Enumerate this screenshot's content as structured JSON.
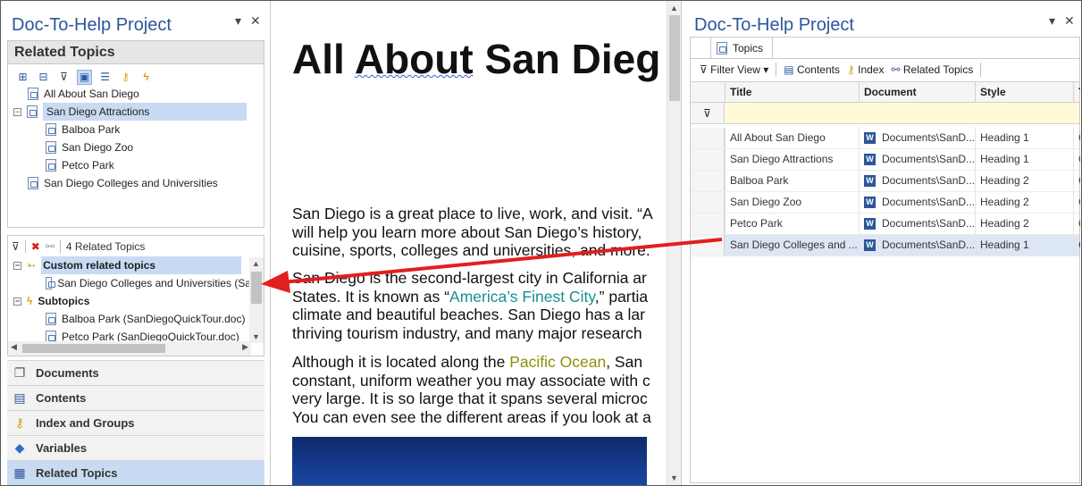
{
  "left_pane": {
    "title": "Doc-To-Help Project",
    "pin": "▾",
    "close": "✕",
    "related_header": "Related Topics",
    "tree": [
      {
        "label": "All About San Diego",
        "level": 1,
        "expander": "",
        "selected": false
      },
      {
        "label": "San Diego Attractions",
        "level": 0,
        "expander": "−",
        "selected": true
      },
      {
        "label": "Balboa Park",
        "level": 2,
        "expander": "",
        "selected": false
      },
      {
        "label": "San Diego Zoo",
        "level": 2,
        "expander": "",
        "selected": false
      },
      {
        "label": "Petco Park",
        "level": 2,
        "expander": "",
        "selected": false
      },
      {
        "label": "San Diego Colleges and Universities",
        "level": 1,
        "expander": "",
        "selected": false
      }
    ],
    "related_count": "4 Related Topics",
    "related_list": [
      {
        "label": "Custom related topics",
        "group": true,
        "expander": "−",
        "selected": true
      },
      {
        "label": "San Diego Colleges and Universities (Sa",
        "group": false,
        "expander": "",
        "selected": false
      },
      {
        "label": "Subtopics",
        "group": true,
        "expander": "−",
        "selected": false
      },
      {
        "label": "Balboa Park (SanDiegoQuickTour.doc)",
        "group": false,
        "expander": "",
        "selected": false
      },
      {
        "label": "Petco Park (SanDiegoQuickTour.doc)",
        "group": false,
        "expander": "",
        "selected": false
      }
    ],
    "nav": [
      {
        "label": "Documents",
        "icon": "documents-icon",
        "active": false
      },
      {
        "label": "Contents",
        "icon": "contents-icon",
        "active": false
      },
      {
        "label": "Index and Groups",
        "icon": "key-icon",
        "active": false
      },
      {
        "label": "Variables",
        "icon": "variables-icon",
        "active": false
      },
      {
        "label": "Related Topics",
        "icon": "related-topics-icon",
        "active": true
      }
    ]
  },
  "document": {
    "heading_part1": "All ",
    "heading_part2": "About",
    "heading_part3": " San Dieg",
    "p1": [
      "San Diego is a great place to live, work, and visit. “A",
      "will help you learn more about San Diego’s history,",
      "cuisine, sports, colleges and universities, and more."
    ],
    "p2a": "San Diego is the second-largest city in California ar",
    "p2b_pre": "States. It is known as “",
    "p2b_link": "America’s Finest City",
    "p2b_post": ",” partia",
    "p2c": "climate and beautiful beaches. San Diego has a lar",
    "p2d": "thriving tourism industry, and many major research",
    "p3a_pre": "Although it is located along the ",
    "p3a_link": "Pacific Ocean",
    "p3a_post": ", San",
    "p3b": "constant, uniform weather you may associate with c",
    "p3c": "very large. It is so large that it spans several microc",
    "p3d": "You can even see the different areas if you look at a"
  },
  "right_pane": {
    "title": "Doc-To-Help Project",
    "pin": "▾",
    "close": "✕",
    "tab": "Topics",
    "toolbar": {
      "filter_view": "Filter View",
      "contents": "Contents",
      "index": "Index",
      "related_topics": "Related Topics"
    },
    "columns": [
      "Title",
      "Document",
      "Style",
      "T"
    ],
    "rows": [
      {
        "title": "All About San Diego",
        "document": "Documents\\SanD...",
        "style": "Heading 1",
        "extra": "C",
        "selected": false
      },
      {
        "title": "San Diego Attractions",
        "document": "Documents\\SanD...",
        "style": "Heading 1",
        "extra": "C",
        "selected": false
      },
      {
        "title": "Balboa Park",
        "document": "Documents\\SanD...",
        "style": "Heading 2",
        "extra": "C",
        "selected": false
      },
      {
        "title": "San Diego Zoo",
        "document": "Documents\\SanD...",
        "style": "Heading 2",
        "extra": "C",
        "selected": false
      },
      {
        "title": "Petco Park",
        "document": "Documents\\SanD...",
        "style": "Heading 2",
        "extra": "C",
        "selected": false
      },
      {
        "title": "San Diego Colleges and ...",
        "document": "Documents\\SanD...",
        "style": "Heading 1",
        "extra": "C",
        "selected": true
      }
    ]
  },
  "colors": {
    "accent": "#2b579a",
    "selection": "#c9daf3",
    "arrow": "#e31e1e",
    "teal_link": "#14918e",
    "olive_link": "#8f8f0a"
  }
}
